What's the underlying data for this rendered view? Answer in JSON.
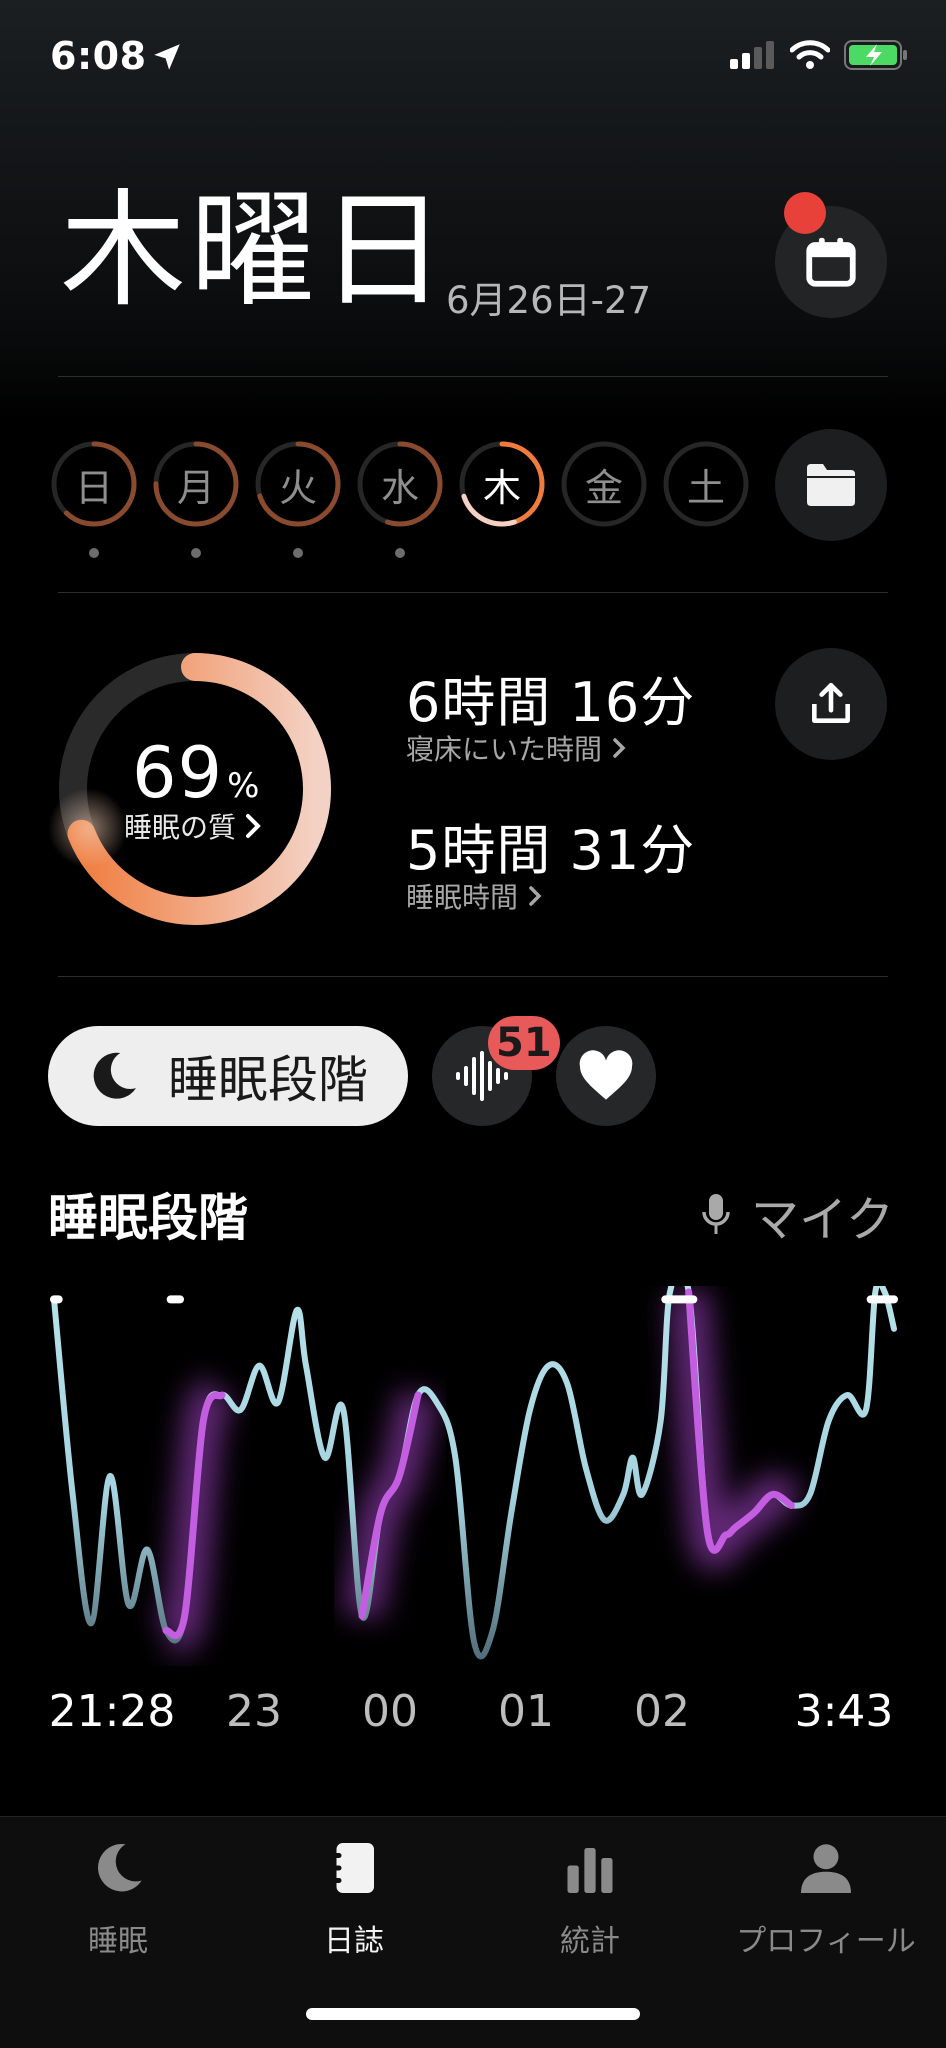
{
  "status": {
    "time": "6:08"
  },
  "header": {
    "day": "木曜日",
    "date_range": "6月26日-27"
  },
  "week": {
    "days": [
      {
        "label": "日",
        "progress": 0.62,
        "has_data": true
      },
      {
        "label": "月",
        "progress": 0.75,
        "has_data": true
      },
      {
        "label": "火",
        "progress": 0.7,
        "has_data": true
      },
      {
        "label": "水",
        "progress": 0.55,
        "has_data": true
      },
      {
        "label": "木",
        "progress": 0.69,
        "has_data": false,
        "active": true
      },
      {
        "label": "金",
        "progress": 0,
        "has_data": false
      },
      {
        "label": "土",
        "progress": 0,
        "has_data": false
      }
    ]
  },
  "summary": {
    "quality_value": "69",
    "quality_unit": "%",
    "quality_label": "睡眠の質",
    "quality_fraction": 0.69,
    "time_in_bed": "6時間 16分",
    "time_in_bed_label": "寝床にいた時間",
    "sleep_time": "5時間 31分",
    "sleep_time_label": "睡眠時間"
  },
  "tabs": {
    "stage_label": "睡眠段階",
    "sound_badge": "51"
  },
  "section": {
    "title": "睡眠段階",
    "mic_label": "マイク"
  },
  "chart_data": {
    "type": "line",
    "x_ticks": [
      "21:28",
      "23",
      "00",
      "01",
      "02",
      "3:43"
    ],
    "points": [
      [
        0,
        0.02
      ],
      [
        2,
        0.55
      ],
      [
        4,
        0.9
      ],
      [
        6,
        0.5
      ],
      [
        8,
        0.85
      ],
      [
        10,
        0.7
      ],
      [
        12,
        0.92
      ],
      [
        14,
        0.88
      ],
      [
        16,
        0.35
      ],
      [
        18,
        0.28
      ],
      [
        20,
        0.32
      ],
      [
        22,
        0.2
      ],
      [
        24,
        0.3
      ],
      [
        26,
        0.05
      ],
      [
        27,
        0.2
      ],
      [
        29,
        0.45
      ],
      [
        31,
        0.32
      ],
      [
        33,
        0.88
      ],
      [
        35,
        0.6
      ],
      [
        37,
        0.5
      ],
      [
        39,
        0.28
      ],
      [
        41,
        0.3
      ],
      [
        43,
        0.45
      ],
      [
        45,
        0.95
      ],
      [
        47,
        0.92
      ],
      [
        49,
        0.6
      ],
      [
        51,
        0.32
      ],
      [
        53,
        0.2
      ],
      [
        55,
        0.25
      ],
      [
        57,
        0.48
      ],
      [
        59,
        0.62
      ],
      [
        61,
        0.55
      ],
      [
        62,
        0.45
      ],
      [
        63,
        0.55
      ],
      [
        65,
        0.35
      ],
      [
        66,
        0.0
      ],
      [
        68,
        0.0
      ],
      [
        70,
        0.65
      ],
      [
        72,
        0.66
      ],
      [
        73,
        0.64
      ],
      [
        75,
        0.6
      ],
      [
        77,
        0.55
      ],
      [
        79,
        0.58
      ],
      [
        81,
        0.55
      ],
      [
        83,
        0.35
      ],
      [
        85,
        0.28
      ],
      [
        87,
        0.32
      ],
      [
        88,
        0.0
      ],
      [
        89,
        0.0
      ],
      [
        90,
        0.1
      ]
    ]
  },
  "nav": {
    "items": [
      {
        "label": "睡眠",
        "icon": "moon-icon"
      },
      {
        "label": "日誌",
        "icon": "journal-icon",
        "active": true
      },
      {
        "label": "統計",
        "icon": "bar-chart-icon"
      },
      {
        "label": "プロフィール",
        "icon": "person-icon"
      }
    ]
  },
  "colors": {
    "accent": "#f07b3c",
    "stage_line": "#a9d6e0",
    "stage_rem": "#c45ee0",
    "badge": "#e8595a"
  }
}
